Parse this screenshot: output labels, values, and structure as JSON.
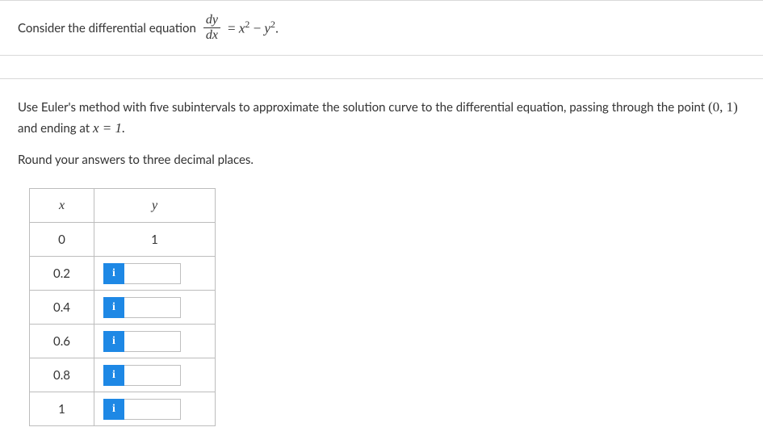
{
  "prompt": {
    "lead": "Consider the differential equation",
    "frac_num": "dy",
    "frac_den": "dx",
    "rhs_eq": "=",
    "rhs_x": "x",
    "rhs_minus": " − ",
    "rhs_y": "y",
    "rhs_sup": "2",
    "rhs_period": "."
  },
  "instructions": {
    "line1a": "Use Euler's method with five subintervals to approximate the solution curve to the differential equation, passing through the point ",
    "point": "(0, 1)",
    "line1b": " and ending at ",
    "xeq": "x = 1.",
    "line2": "Round your answers to three decimal places."
  },
  "table": {
    "header_x": "x",
    "header_y": "y",
    "rows": [
      {
        "x": "0",
        "y": "1",
        "editable": false
      },
      {
        "x": "0.2",
        "y": "",
        "editable": true
      },
      {
        "x": "0.4",
        "y": "",
        "editable": true
      },
      {
        "x": "0.6",
        "y": "",
        "editable": true
      },
      {
        "x": "0.8",
        "y": "",
        "editable": true
      },
      {
        "x": "1",
        "y": "",
        "editable": true
      }
    ]
  },
  "icons": {
    "info": "i"
  }
}
